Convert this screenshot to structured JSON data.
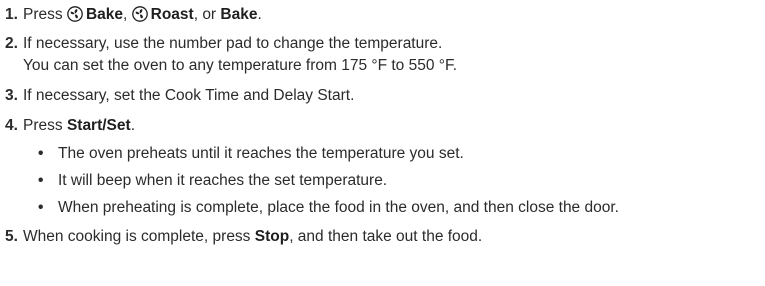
{
  "steps": [
    {
      "num": "1.",
      "press": "Press",
      "bake_fan": "Bake",
      "sep1": ",",
      "roast_fan": "Roast",
      "sep2": ", or",
      "bake": "Bake",
      "end": "."
    },
    {
      "num": "2.",
      "line1": "If necessary, use the number pad to change the temperature.",
      "line2": "You can set the oven to any temperature from 175 °F to 550 °F."
    },
    {
      "num": "3.",
      "text": "If necessary, set the Cook Time and Delay Start."
    },
    {
      "num": "4.",
      "press": "Press",
      "button": "Start/Set",
      "end": ".",
      "bullets": [
        "The oven preheats until it reaches the temperature you set.",
        "It will beep when it reaches the set temperature.",
        "When preheating is complete, place the food in the oven, and then close the door."
      ]
    },
    {
      "num": "5.",
      "before": "When cooking is complete, press",
      "button": "Stop",
      "after": ", and then take out the food."
    }
  ],
  "icons": {
    "convection": "convection-fan-icon"
  }
}
